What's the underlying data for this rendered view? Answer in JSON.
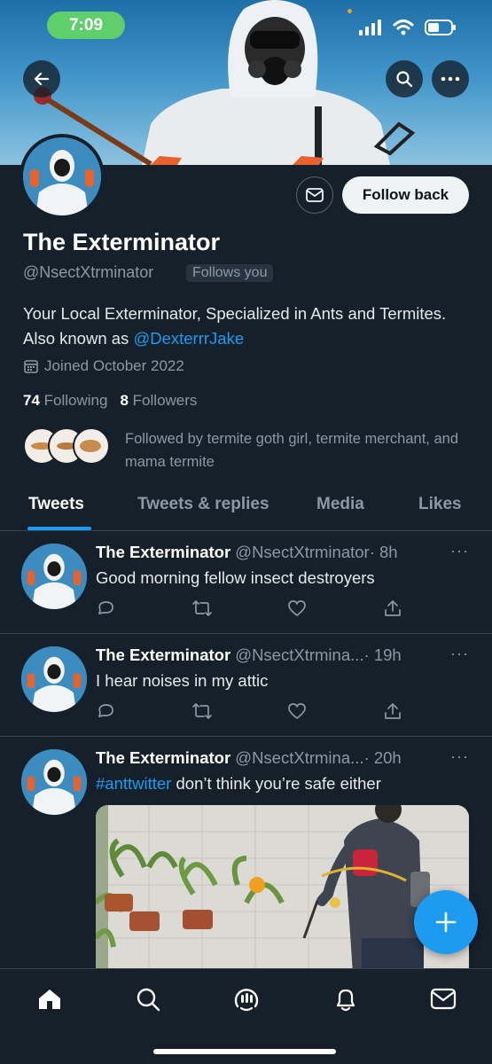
{
  "status": {
    "time": "7:09"
  },
  "profile": {
    "name": "The Exterminator",
    "handle": "@NsectXtrminator",
    "follows_you": "Follows you",
    "follow_back": "Follow back",
    "bio_text": "Your Local Exterminator, Specialized in Ants and Termites. Also known as ",
    "bio_link": "@DexterrrJake",
    "joined": "Joined October 2022",
    "following_count": "74",
    "following_label": "Following",
    "followers_count": "8",
    "followers_label": "Followers",
    "followed_by": "Followed by termite goth girl, termite merchant, and mama termite"
  },
  "tabs": [
    "Tweets",
    "Tweets & replies",
    "Media",
    "Likes"
  ],
  "tweets": [
    {
      "name": "The Exterminator",
      "handle": "@NsectXtrminator",
      "time": "· 8h",
      "text": "Good morning fellow insect destroyers"
    },
    {
      "name": "The Exterminator",
      "handle": "@NsectXtrmina...",
      "time": "· 19h",
      "text": "I hear noises in my attic"
    },
    {
      "name": "The Exterminator",
      "handle": "@NsectXtrmina...",
      "time": "· 20h",
      "hashtag": "#anttwitter",
      "text": " don’t think you’re safe either"
    }
  ],
  "more_glyph": "···",
  "icons": [
    "back-arrow-icon",
    "search-icon",
    "more-icon",
    "mail-icon",
    "calendar-icon",
    "reply-icon",
    "retweet-icon",
    "like-icon",
    "share-icon",
    "compose-plus-icon",
    "home-icon",
    "spaces-icon",
    "notifications-icon",
    "messages-icon"
  ],
  "colors": {
    "accent": "#1d9bf0",
    "background": "#15202b",
    "muted": "#8b98a5"
  }
}
